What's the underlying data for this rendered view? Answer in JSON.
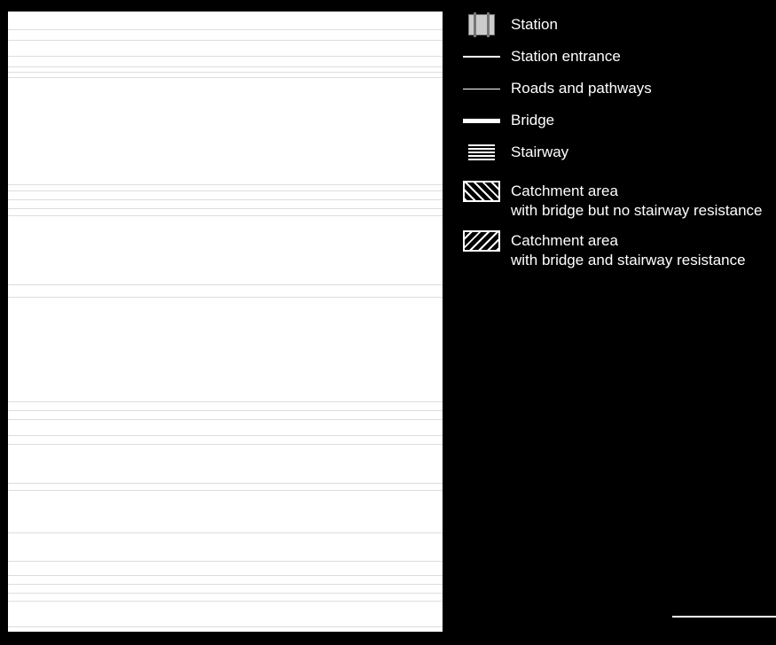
{
  "legend": {
    "station": "Station",
    "entrance": "Station entrance",
    "roads": "Roads and pathways",
    "bridge": "Bridge",
    "stairway": "Stairway",
    "catch1a": "Catchment area",
    "catch1b": "with bridge but no stairway resistance",
    "catch2a": "Catchment area",
    "catch2b": " with bridge and stairway resistance"
  }
}
